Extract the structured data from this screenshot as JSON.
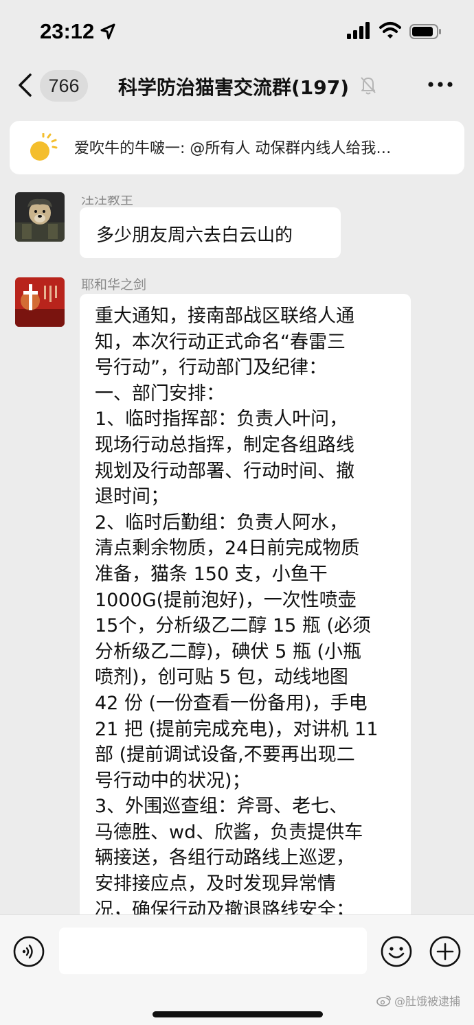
{
  "status_bar": {
    "time": "23:12",
    "icons": [
      "location-arrow-icon",
      "cellular-signal-icon",
      "wifi-icon",
      "battery-icon"
    ]
  },
  "nav": {
    "unread_count": "766",
    "title": "科学防治猫害交流群(197)",
    "icons": [
      "back-icon",
      "mute-icon",
      "more-icon"
    ]
  },
  "pinned": {
    "text": "爱吹牛的牛啵一: @所有人 动保群内线人给我…",
    "icon": "sun-icon"
  },
  "messages": [
    {
      "sender": "汪汪教主",
      "text": "多少朋友周六去白云山的"
    },
    {
      "sender": "耶和华之剑",
      "lines": [
        "重大通知，接南部战区联络人通",
        "知，本次行动正式命名“春雷三",
        "号行动”，行动部门及纪律：",
        "一、部门安排：",
        "1、临时指挥部：负责人叶问，",
        "现场行动总指挥，制定各组路线",
        "规划及行动部署、行动时间、撤",
        "退时间；",
        "2、临时后勤组：负责人阿水，",
        "清点剩余物质，24日前完成物质",
        "准备，猫条 150 支，小鱼干",
        "1000G(提前泡好)，一次性喷壶",
        "15个，分析级乙二醇 15 瓶 (必须",
        "分析级乙二醇)，碘伏 5 瓶 (小瓶",
        "喷剂)，创可贴 5 包，动线地图",
        "42 份 (一份查看一份备用)，手电",
        "21 把 (提前完成充电)，对讲机 11",
        "部 (提前调试设备,不要再出现二",
        "号行动中的状况)；",
        "3、外围巡查组：斧哥、老七、",
        "马德胜、wd、欣酱，负责提供车",
        "辆接送，各组行动路线上巡逻，",
        "安排接应点，及时发现异常情",
        "况，确保行动及撤退路线安全；"
      ]
    }
  ],
  "input_bar": {
    "placeholder": "",
    "icons": [
      "voice-icon",
      "emoji-icon",
      "plus-icon"
    ]
  },
  "watermark": "@肚饿被逮捕",
  "colors": {
    "background": "#ececec",
    "bubble": "#ffffff",
    "sender_name": "#8a8a8a",
    "badge": "#dcdcdc",
    "input_bar": "#f6f6f6"
  }
}
